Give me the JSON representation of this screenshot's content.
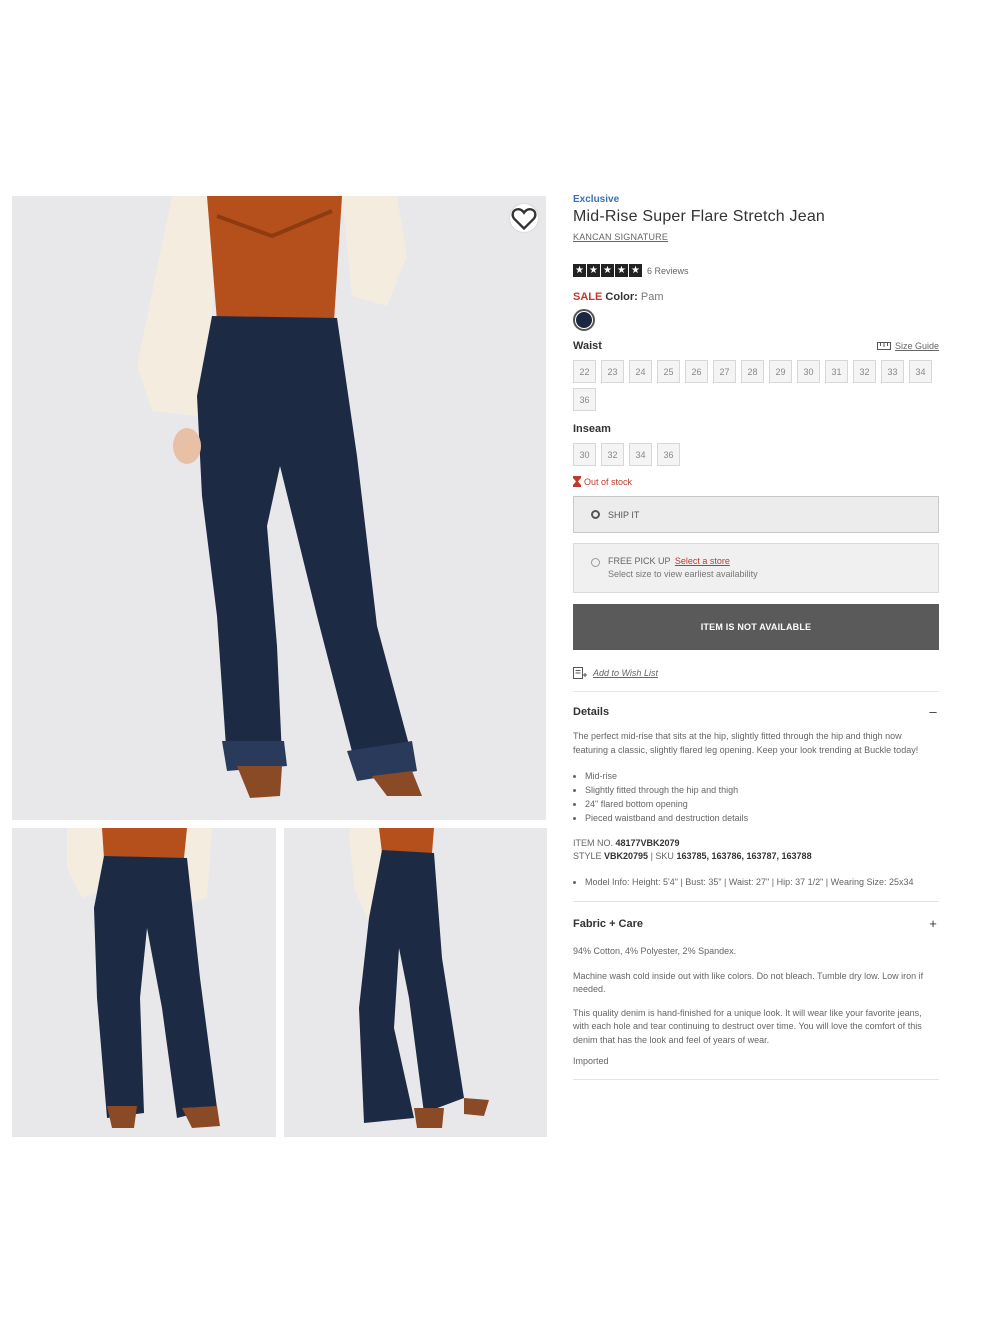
{
  "gallery": {
    "wishlist_icon": "heart-outline-icon"
  },
  "product": {
    "eyebrow": "Exclusive",
    "title": "Mid-Rise Super Flare Stretch Jean",
    "brand": "KANCAN SIGNATURE",
    "rating": {
      "stars": 5,
      "max": 5,
      "reviews_label": "6 Reviews"
    },
    "sale_label": "SALE",
    "color_label": "Color:",
    "color_value": "Pam",
    "swatch_color": "#1b2740"
  },
  "waist": {
    "label": "Waist",
    "size_guide": "Size Guide",
    "sizes": [
      "22",
      "23",
      "24",
      "25",
      "26",
      "27",
      "28",
      "29",
      "30",
      "31",
      "32",
      "33",
      "34",
      "36"
    ]
  },
  "inseam": {
    "label": "Inseam",
    "sizes": [
      "30",
      "32",
      "34",
      "36"
    ]
  },
  "stock": {
    "out_of_stock": "Out of stock"
  },
  "fulfillment": {
    "ship_label": "SHIP IT",
    "pickup_label": "FREE PICK UP",
    "pickup_link": "Select a store",
    "pickup_sub": "Select size to view earliest availability"
  },
  "cta": {
    "unavailable": "ITEM IS NOT AVAILABLE"
  },
  "wishlist": {
    "label": "Add to Wish List"
  },
  "details": {
    "title": "Details",
    "toggle": "–",
    "description": "The perfect mid-rise that sits at the hip, slightly fitted through the hip and thigh now featuring a classic, slightly flared leg opening. Keep your look trending at Buckle today!",
    "bullets": [
      "Mid-rise",
      "Slightly fitted through the hip and thigh",
      "24\" flared bottom opening",
      "Pieced waistband and destruction details"
    ],
    "item_no_label": "ITEM NO.",
    "item_no": "48177VBK2079",
    "style_label": "STYLE",
    "style": "VBK20795",
    "sku_label": "| SKU",
    "sku": "163785, 163786, 163787, 163788",
    "model_info": "Model Info: Height: 5'4\" | Bust: 35\" | Waist: 27\" | Hip: 37 1/2\" | Wearing Size: 25x34"
  },
  "fabric": {
    "title": "Fabric + Care",
    "toggle": "+",
    "content": "94% Cotton, 4% Polyester, 2% Spandex.",
    "wash": "Machine wash cold inside out with like colors. Do not bleach. Tumble dry low. Low iron if needed.",
    "quality": "This quality denim is hand-finished for a unique look. It will wear like your favorite jeans, with each hole and tear continuing to destruct over time. You will love the comfort of this denim that has the look and feel of years of wear.",
    "origin": "Imported"
  },
  "colors": {
    "accent_blue": "#3d6fb8",
    "sale_red": "#c0392b",
    "button_gray": "#5a5a5a",
    "denim": "#1d2a44",
    "top_rust": "#b5501c"
  }
}
